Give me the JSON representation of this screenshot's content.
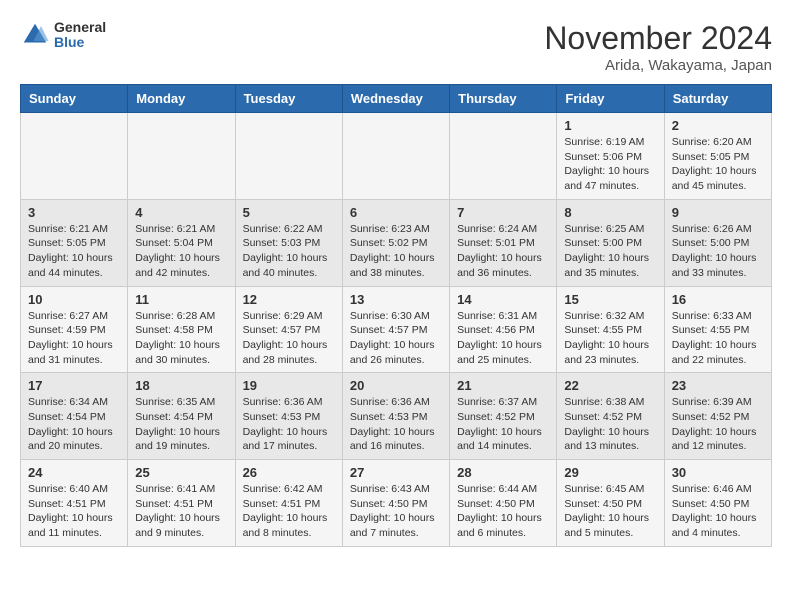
{
  "logo": {
    "general": "General",
    "blue": "Blue"
  },
  "title": "November 2024",
  "subtitle": "Arida, Wakayama, Japan",
  "headers": [
    "Sunday",
    "Monday",
    "Tuesday",
    "Wednesday",
    "Thursday",
    "Friday",
    "Saturday"
  ],
  "weeks": [
    [
      {
        "day": "",
        "info": ""
      },
      {
        "day": "",
        "info": ""
      },
      {
        "day": "",
        "info": ""
      },
      {
        "day": "",
        "info": ""
      },
      {
        "day": "",
        "info": ""
      },
      {
        "day": "1",
        "info": "Sunrise: 6:19 AM\nSunset: 5:06 PM\nDaylight: 10 hours\nand 47 minutes."
      },
      {
        "day": "2",
        "info": "Sunrise: 6:20 AM\nSunset: 5:05 PM\nDaylight: 10 hours\nand 45 minutes."
      }
    ],
    [
      {
        "day": "3",
        "info": "Sunrise: 6:21 AM\nSunset: 5:05 PM\nDaylight: 10 hours\nand 44 minutes."
      },
      {
        "day": "4",
        "info": "Sunrise: 6:21 AM\nSunset: 5:04 PM\nDaylight: 10 hours\nand 42 minutes."
      },
      {
        "day": "5",
        "info": "Sunrise: 6:22 AM\nSunset: 5:03 PM\nDaylight: 10 hours\nand 40 minutes."
      },
      {
        "day": "6",
        "info": "Sunrise: 6:23 AM\nSunset: 5:02 PM\nDaylight: 10 hours\nand 38 minutes."
      },
      {
        "day": "7",
        "info": "Sunrise: 6:24 AM\nSunset: 5:01 PM\nDaylight: 10 hours\nand 36 minutes."
      },
      {
        "day": "8",
        "info": "Sunrise: 6:25 AM\nSunset: 5:00 PM\nDaylight: 10 hours\nand 35 minutes."
      },
      {
        "day": "9",
        "info": "Sunrise: 6:26 AM\nSunset: 5:00 PM\nDaylight: 10 hours\nand 33 minutes."
      }
    ],
    [
      {
        "day": "10",
        "info": "Sunrise: 6:27 AM\nSunset: 4:59 PM\nDaylight: 10 hours\nand 31 minutes."
      },
      {
        "day": "11",
        "info": "Sunrise: 6:28 AM\nSunset: 4:58 PM\nDaylight: 10 hours\nand 30 minutes."
      },
      {
        "day": "12",
        "info": "Sunrise: 6:29 AM\nSunset: 4:57 PM\nDaylight: 10 hours\nand 28 minutes."
      },
      {
        "day": "13",
        "info": "Sunrise: 6:30 AM\nSunset: 4:57 PM\nDaylight: 10 hours\nand 26 minutes."
      },
      {
        "day": "14",
        "info": "Sunrise: 6:31 AM\nSunset: 4:56 PM\nDaylight: 10 hours\nand 25 minutes."
      },
      {
        "day": "15",
        "info": "Sunrise: 6:32 AM\nSunset: 4:55 PM\nDaylight: 10 hours\nand 23 minutes."
      },
      {
        "day": "16",
        "info": "Sunrise: 6:33 AM\nSunset: 4:55 PM\nDaylight: 10 hours\nand 22 minutes."
      }
    ],
    [
      {
        "day": "17",
        "info": "Sunrise: 6:34 AM\nSunset: 4:54 PM\nDaylight: 10 hours\nand 20 minutes."
      },
      {
        "day": "18",
        "info": "Sunrise: 6:35 AM\nSunset: 4:54 PM\nDaylight: 10 hours\nand 19 minutes."
      },
      {
        "day": "19",
        "info": "Sunrise: 6:36 AM\nSunset: 4:53 PM\nDaylight: 10 hours\nand 17 minutes."
      },
      {
        "day": "20",
        "info": "Sunrise: 6:36 AM\nSunset: 4:53 PM\nDaylight: 10 hours\nand 16 minutes."
      },
      {
        "day": "21",
        "info": "Sunrise: 6:37 AM\nSunset: 4:52 PM\nDaylight: 10 hours\nand 14 minutes."
      },
      {
        "day": "22",
        "info": "Sunrise: 6:38 AM\nSunset: 4:52 PM\nDaylight: 10 hours\nand 13 minutes."
      },
      {
        "day": "23",
        "info": "Sunrise: 6:39 AM\nSunset: 4:52 PM\nDaylight: 10 hours\nand 12 minutes."
      }
    ],
    [
      {
        "day": "24",
        "info": "Sunrise: 6:40 AM\nSunset: 4:51 PM\nDaylight: 10 hours\nand 11 minutes."
      },
      {
        "day": "25",
        "info": "Sunrise: 6:41 AM\nSunset: 4:51 PM\nDaylight: 10 hours\nand 9 minutes."
      },
      {
        "day": "26",
        "info": "Sunrise: 6:42 AM\nSunset: 4:51 PM\nDaylight: 10 hours\nand 8 minutes."
      },
      {
        "day": "27",
        "info": "Sunrise: 6:43 AM\nSunset: 4:50 PM\nDaylight: 10 hours\nand 7 minutes."
      },
      {
        "day": "28",
        "info": "Sunrise: 6:44 AM\nSunset: 4:50 PM\nDaylight: 10 hours\nand 6 minutes."
      },
      {
        "day": "29",
        "info": "Sunrise: 6:45 AM\nSunset: 4:50 PM\nDaylight: 10 hours\nand 5 minutes."
      },
      {
        "day": "30",
        "info": "Sunrise: 6:46 AM\nSunset: 4:50 PM\nDaylight: 10 hours\nand 4 minutes."
      }
    ]
  ]
}
